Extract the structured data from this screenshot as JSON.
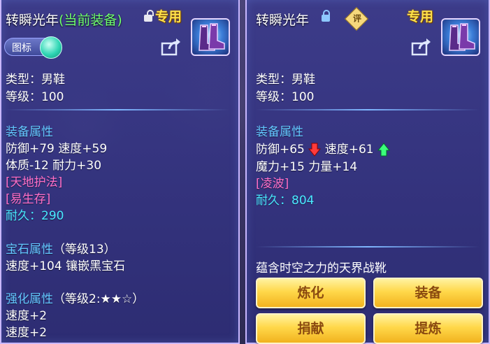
{
  "left_panel": {
    "title": "转瞬光年",
    "title_status": "(当前装备)",
    "special_label": "专用",
    "toggle_label": "图标",
    "type_line": "类型：男鞋",
    "level_line": "等级：100",
    "attr_header": "装备属性",
    "attr_line1": "防御+79 速度+59",
    "attr_line2": "体质-12 耐力+30",
    "skill1": "[天地护法]",
    "skill2": "[易生存]",
    "durability_label": "耐久：",
    "durability_value": "290",
    "gem_header": "宝石属性",
    "gem_level": "（等级13）",
    "gem_line": "速度+104 镶嵌黑宝石",
    "enhance_header": "强化属性",
    "enhance_level": "（等级2:★★☆）",
    "enhance_line1": "速度+2",
    "enhance_line2": "速度+2"
  },
  "right_panel": {
    "title": "转瞬光年",
    "rate_label": "评",
    "special_label": "专用",
    "type_line": "类型：男鞋",
    "level_line": "等级：100",
    "attr_header": "装备属性",
    "defense": "防御+65",
    "speed": "速度+61",
    "attr_line2": "魔力+15 力量+14",
    "skill1": "[凌波]",
    "durability_label": "耐久：",
    "durability_value": "804",
    "description": "蕴含时空之力的天界战靴",
    "buttons": [
      "炼化",
      "装备",
      "捐献",
      "提炼"
    ]
  },
  "colors": {
    "section_blue": "#63c7ff",
    "skill_pink": "#ff6fc8",
    "durability_cyan": "#49e9ff",
    "special_gold": "#ffe14a",
    "current_green": "#6fff6f",
    "arrow_down_red": "#ff3b3b",
    "arrow_up_green": "#3bff7a"
  },
  "icons": [
    "lock-open-icon",
    "lock-icon",
    "share-icon",
    "boots-icon",
    "arrow-down-icon",
    "arrow-up-icon"
  ]
}
